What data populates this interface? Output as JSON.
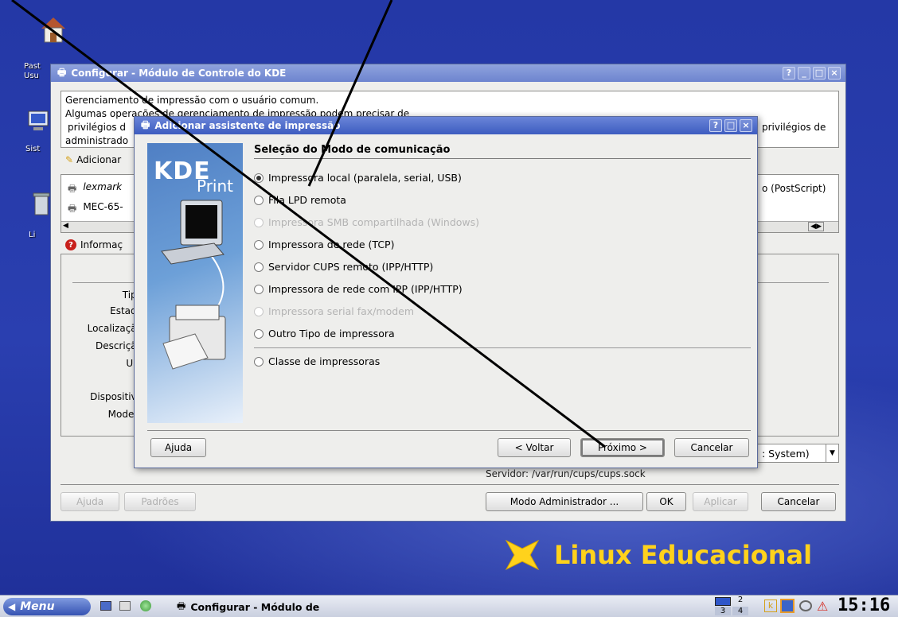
{
  "desktop": {
    "icons": [
      "Past",
      "Usu",
      "Sist",
      "Li"
    ],
    "brand": "Linux Educacional"
  },
  "main_window": {
    "title": "Configurar - Módulo de Controle do KDE",
    "description": [
      "Gerenciamento de impressão com o usuário comum.",
      "Algumas operações de gerenciamento de impressão podem precisar de",
      "privilégios d",
      "privilégios de",
      "administrado"
    ],
    "toolbar_add": "Adicionar",
    "printers": [
      "lexmark",
      "MEC-65-"
    ],
    "printer_desc_right": "o (PostScript)",
    "info_tab": "Informaç",
    "fields": [
      "Tipo",
      "Estado",
      "Localização",
      "Descrição",
      "URI",
      "Dispositivo",
      "Modelo"
    ],
    "system_combo": ": System)",
    "server": "Servidor: /var/run/cups/cups.sock",
    "buttons": {
      "help": "Ajuda",
      "defaults": "Padrões",
      "admin": "Modo Administrador ...",
      "ok": "OK",
      "apply": "Aplicar",
      "cancel": "Cancelar"
    }
  },
  "wizard": {
    "title": "Adicionar assistente de impressão",
    "logo_kde": "KDE",
    "logo_print": "Print",
    "heading": "Seleção do Modo de comunicação",
    "options": [
      {
        "label": "Impressora local (paralela, serial, USB)",
        "checked": true,
        "enabled": true
      },
      {
        "label": "Fila LPD remota",
        "checked": false,
        "enabled": true
      },
      {
        "label": "Impressora SMB compartilhada (Windows)",
        "checked": false,
        "enabled": false
      },
      {
        "label": "Impressora de rede (TCP)",
        "checked": false,
        "enabled": true
      },
      {
        "label": "Servidor CUPS remoto (IPP/HTTP)",
        "checked": false,
        "enabled": true
      },
      {
        "label": "Impressora de rede com IPP (IPP/HTTP)",
        "checked": false,
        "enabled": true
      },
      {
        "label": "Impressora serial fax/modem",
        "checked": false,
        "enabled": false
      },
      {
        "label": "Outro Tipo de impressora",
        "checked": false,
        "enabled": true
      },
      {
        "label": "Classe de impressoras",
        "checked": false,
        "enabled": true
      }
    ],
    "buttons": {
      "help": "Ajuda",
      "back": "< Voltar",
      "next": "Próximo >",
      "cancel": "Cancelar"
    }
  },
  "taskbar": {
    "menu": "Menu",
    "task": "Configurar - Módulo de",
    "desktops": [
      "2",
      "3",
      "4"
    ],
    "clock": "15:16"
  },
  "colors": {
    "accent": "#3d5cc0",
    "desktop": "#2438a6",
    "brand": "#ffd21c"
  }
}
